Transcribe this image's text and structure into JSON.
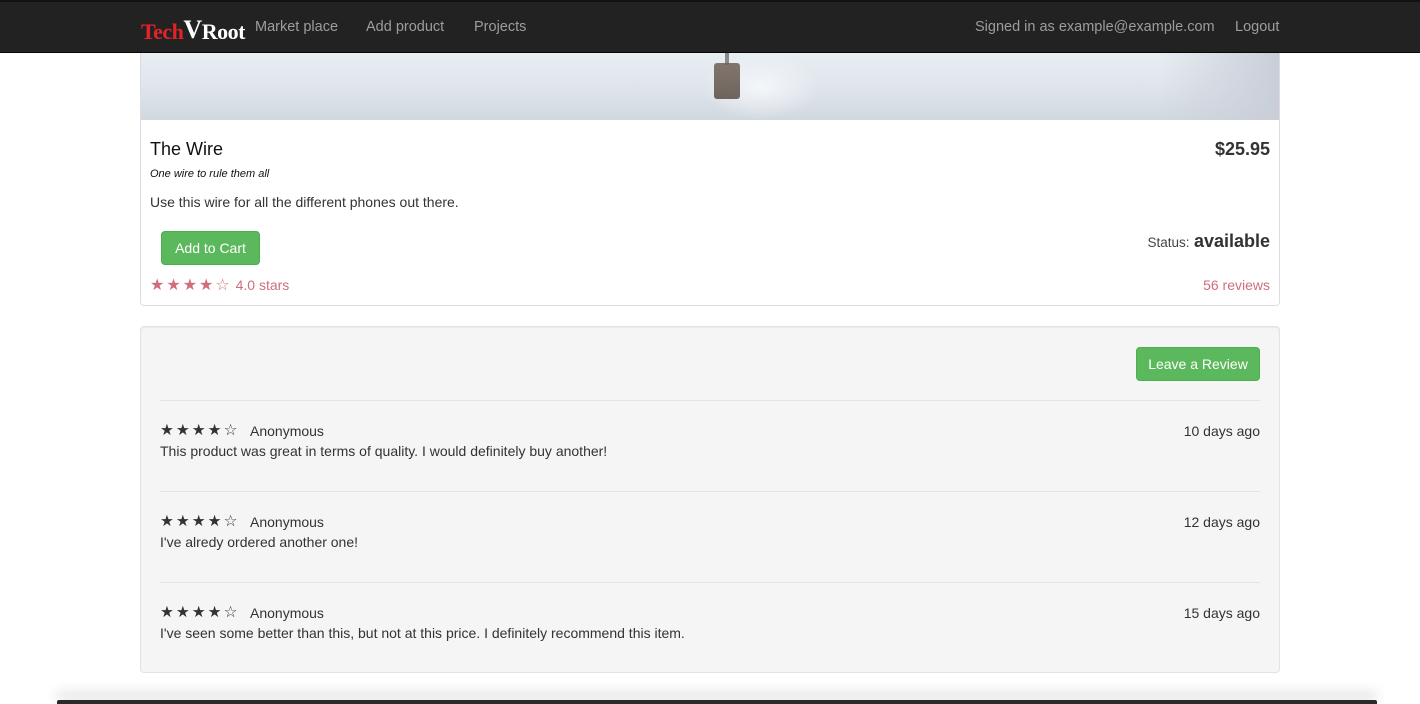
{
  "navbar": {
    "brand": {
      "part1": "Tech",
      "part2": "V",
      "part3": "Root"
    },
    "links": {
      "marketplace": "Market place",
      "add_product": "Add product",
      "projects": "Projects"
    },
    "signed_in": "Signed in as example@example.com",
    "logout": "Logout"
  },
  "product": {
    "title": "The Wire",
    "price": "$25.95",
    "tagline": "One wire to rule them all",
    "description": "Use this wire for all the different phones out there.",
    "add_to_cart": "Add to Cart",
    "status_label": "Status:",
    "status_value": "available",
    "rating_stars": "★★★★☆",
    "rating_text": "4.0 stars",
    "rating_value": 4.0,
    "reviews_count": "56 reviews"
  },
  "reviews": {
    "leave_review": "Leave a Review",
    "items": [
      {
        "stars": "★★★★☆",
        "rating": 4,
        "author": "Anonymous",
        "date": "10 days ago",
        "text": "This product was great in terms of quality. I would definitely buy another!"
      },
      {
        "stars": "★★★★☆",
        "rating": 4,
        "author": "Anonymous",
        "date": "12 days ago",
        "text": "I've alredy ordered another one!"
      },
      {
        "stars": "★★★★☆",
        "rating": 4,
        "author": "Anonymous",
        "date": "15 days ago",
        "text": "I've seen some better than this, but not at this price. I definitely recommend this item."
      }
    ]
  },
  "colors": {
    "navbar_bg": "#222222",
    "brand_red": "#e2232a",
    "success_green": "#5cb85c",
    "rating_pink": "#cf6e7b",
    "well_bg": "#f5f5f5"
  }
}
